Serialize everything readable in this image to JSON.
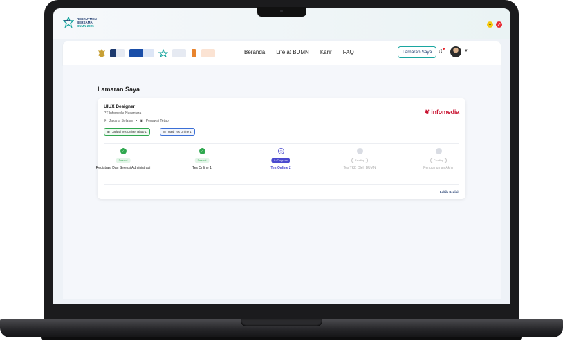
{
  "brand": {
    "line1": "REKRUTMEN",
    "line2": "BERSAMA",
    "line3": "BUMN 2025"
  },
  "colors": {
    "primary": "#1e3a6e",
    "teal": "#1aa6a0",
    "success": "#2fa84f",
    "progress": "#4b4acf",
    "pending": "#bdbdbd"
  },
  "nav": {
    "links": [
      "Beranda",
      "Life at BUMN",
      "Karir",
      "FAQ"
    ],
    "cta": "Lamaran Saya"
  },
  "page": {
    "title": "Lamaran Saya"
  },
  "job": {
    "title": "UIUX Designer",
    "company": "PT Infomedia Nusantara",
    "location": "Jakarta Selatan",
    "type": "Pegawai Tetap",
    "schedule_label": "Jadwal Tes Online Tahap 1",
    "result_label": "Hasil Tes Online 1",
    "logo": "infomedia",
    "more": "Lebih Sedikit"
  },
  "steps": [
    {
      "status": "Passed",
      "label": "Registrasi Dan Seleksi Administrasi"
    },
    {
      "status": "Passed",
      "label": "Tes Online 1"
    },
    {
      "status": "In Progress",
      "label": "Tes Online 2"
    },
    {
      "status": "Pending",
      "label": "Tes TKB Oleh BUMN"
    },
    {
      "status": "Pending",
      "label": "Pengumuman Akhir"
    }
  ]
}
